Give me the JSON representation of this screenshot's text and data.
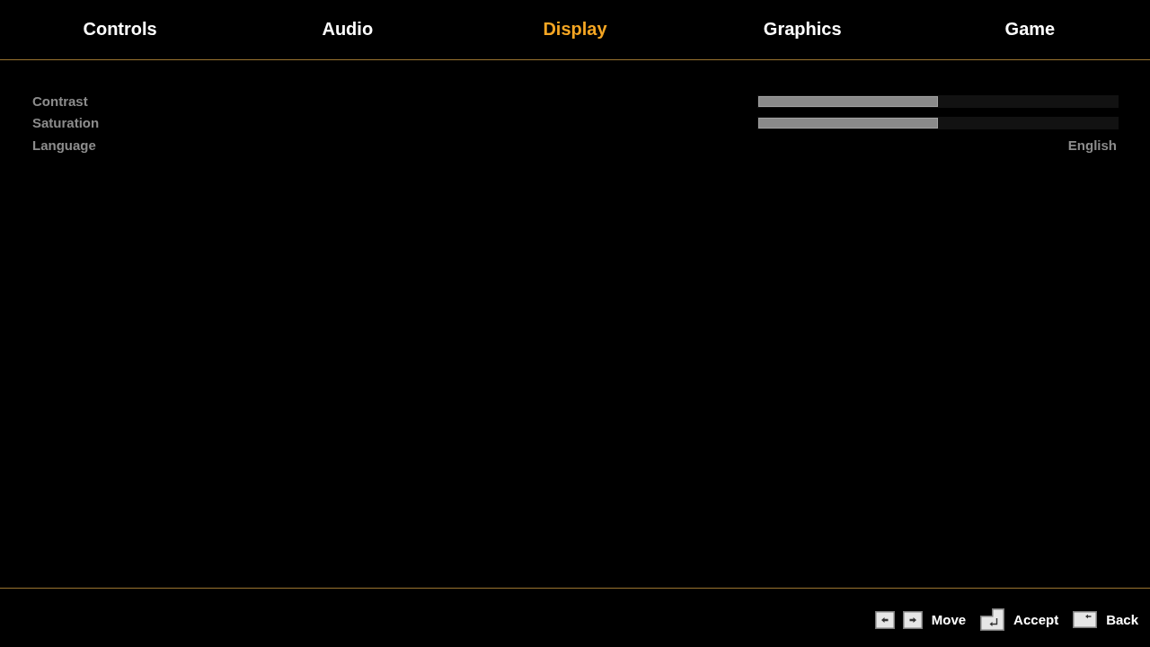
{
  "tabs": [
    {
      "label": "Controls",
      "selected": false
    },
    {
      "label": "Audio",
      "selected": false
    },
    {
      "label": "Display",
      "selected": true
    },
    {
      "label": "Graphics",
      "selected": false
    },
    {
      "label": "Game",
      "selected": false
    }
  ],
  "settings": {
    "items": [
      {
        "kind": "slider",
        "label": "Contrast",
        "level": 0.5
      },
      {
        "kind": "slider",
        "label": "Saturation",
        "level": 0.5
      },
      {
        "kind": "choice",
        "label": "Language",
        "value": "English"
      }
    ]
  },
  "footer": {
    "hints": [
      {
        "keys": [
          {
            "kind": "left"
          },
          {
            "kind": "right"
          }
        ],
        "label": "Move"
      },
      {
        "keys": [
          {
            "kind": "enter"
          }
        ],
        "label": "Accept"
      },
      {
        "keys": [
          {
            "kind": "backspace"
          }
        ],
        "label": "Back"
      }
    ]
  }
}
